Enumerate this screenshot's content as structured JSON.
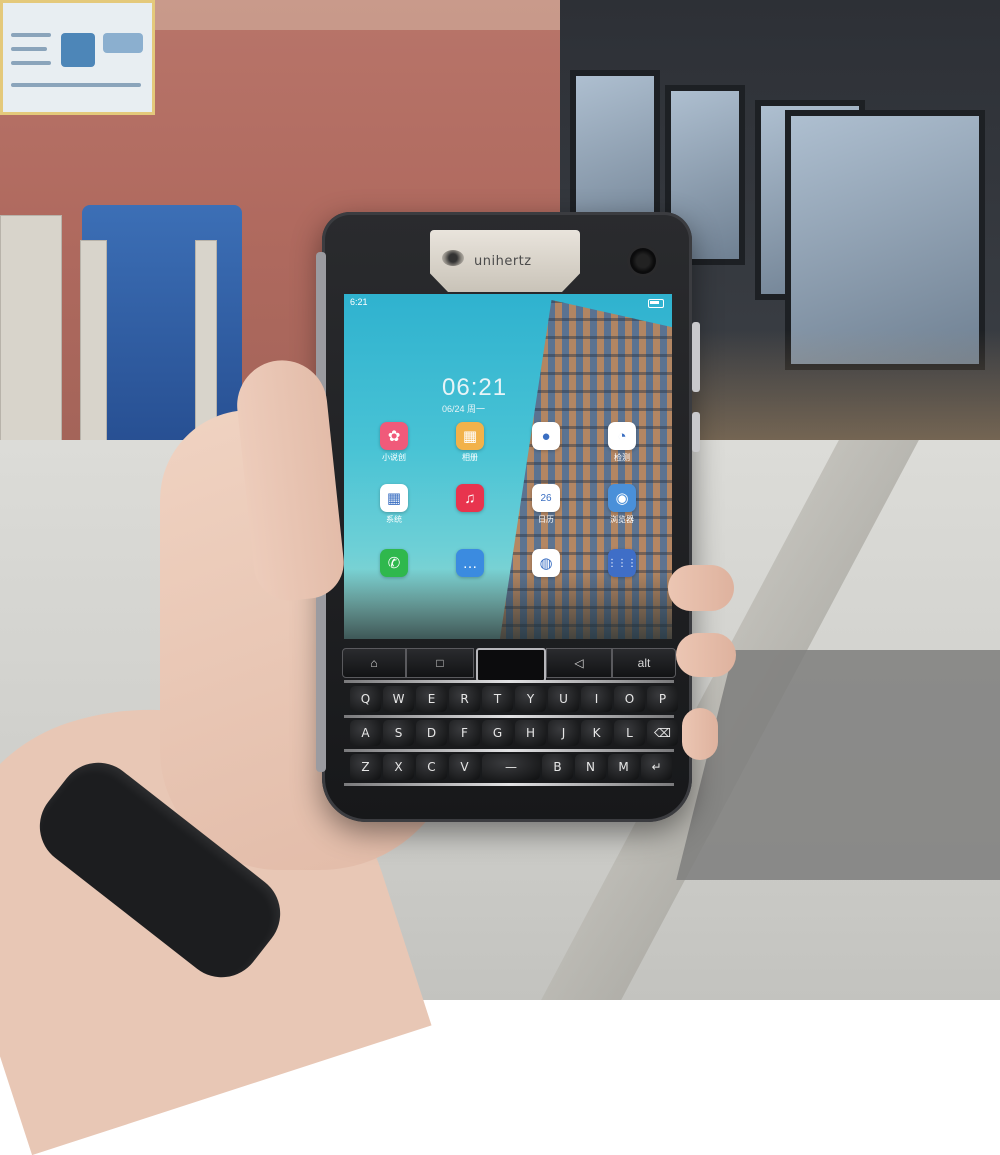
{
  "phone": {
    "brand": "unihertz",
    "status_time": "6:21",
    "clock": "06:21",
    "date": "06/24 周一"
  },
  "apps": [
    {
      "name": "小说创",
      "color": "#f05a7a",
      "glyph": "✿"
    },
    {
      "name": "相册",
      "color": "#f2b24a",
      "glyph": "▦"
    },
    {
      "name": "",
      "color": "#ffffff",
      "glyph": "●"
    },
    {
      "name": "检测",
      "color": "#ffffff",
      "glyph": "◔"
    },
    {
      "name": "系统",
      "color": "#ffffff",
      "glyph": "▦"
    },
    {
      "name": "",
      "color": "#e8344e",
      "glyph": "♫"
    },
    {
      "name": "日历",
      "color": "#ffffff",
      "glyph": "26"
    },
    {
      "name": "浏览器",
      "color": "#4a90d9",
      "glyph": "◉"
    },
    {
      "name": "",
      "color": "#2fb84d",
      "glyph": "✆"
    },
    {
      "name": "",
      "color": "#3b8be0",
      "glyph": "…"
    },
    {
      "name": "",
      "color": "#ffffff",
      "glyph": "◍"
    },
    {
      "name": "",
      "color": "#3f6ec7",
      "glyph": "⋮⋮⋮"
    }
  ],
  "nav_keys": {
    "home": "⌂",
    "recents": "□",
    "back": "◁",
    "alt": "alt"
  },
  "keyboard_rows": [
    [
      "Q",
      "W",
      "E",
      "R",
      "T",
      "Y",
      "U",
      "I",
      "O",
      "P"
    ],
    [
      "A",
      "S",
      "D",
      "F",
      "G",
      "H",
      "J",
      "K",
      "L",
      "⌫"
    ],
    [
      "Z",
      "X",
      "C",
      "V",
      "—",
      "B",
      "N",
      "M",
      "↵"
    ]
  ]
}
